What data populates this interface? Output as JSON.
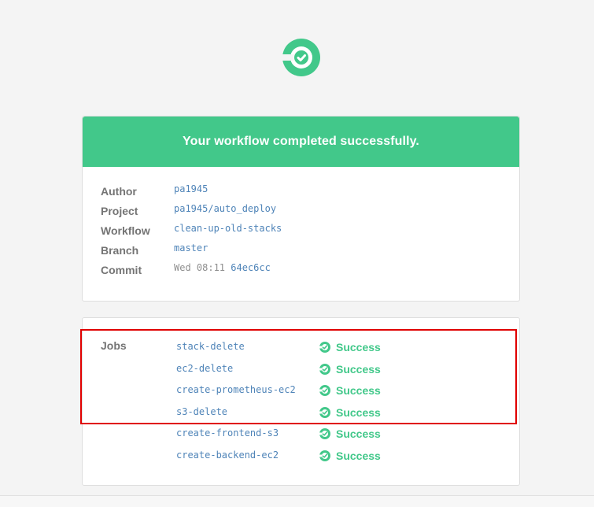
{
  "header": {
    "logo_icon": "circleci-logo-icon"
  },
  "summary": {
    "banner_title": "Your workflow completed successfully.",
    "rows": [
      {
        "label": "Author",
        "value": "pa1945"
      },
      {
        "label": "Project",
        "value": "pa1945/auto_deploy"
      },
      {
        "label": "Workflow",
        "value": "clean-up-old-stacks"
      },
      {
        "label": "Branch",
        "value": "master"
      },
      {
        "label": "Commit",
        "time": "Wed 08:11",
        "hash": "64ec6cc"
      }
    ]
  },
  "jobs": {
    "label": "Jobs",
    "items": [
      {
        "name": "stack-delete",
        "status": "Success",
        "icon": "success-check-icon"
      },
      {
        "name": "ec2-delete",
        "status": "Success",
        "icon": "success-check-icon"
      },
      {
        "name": "create-prometheus-ec2",
        "status": "Success",
        "icon": "success-check-icon"
      },
      {
        "name": "s3-delete",
        "status": "Success",
        "icon": "success-check-icon"
      },
      {
        "name": "create-frontend-s3",
        "status": "Success",
        "icon": "success-check-icon"
      },
      {
        "name": "create-backend-ec2",
        "status": "Success",
        "icon": "success-check-icon"
      }
    ]
  },
  "colors": {
    "accent": "#42c88a",
    "link": "#4f84b8",
    "label": "#747474",
    "muted": "#8f8f8f",
    "highlight": "#e00000"
  }
}
